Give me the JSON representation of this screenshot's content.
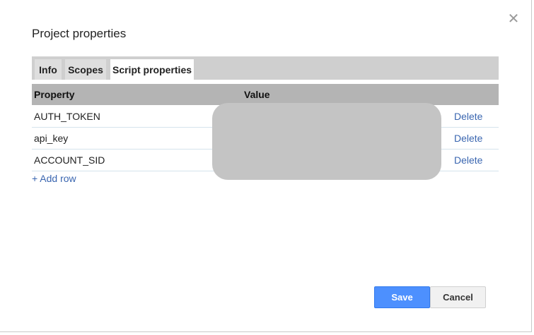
{
  "dialog": {
    "title": "Project properties",
    "close_icon": "close-icon"
  },
  "tabs": [
    {
      "label": "Info",
      "active": false
    },
    {
      "label": "Scopes",
      "active": false
    },
    {
      "label": "Script properties",
      "active": true
    }
  ],
  "table": {
    "columns": [
      "Property",
      "Value"
    ],
    "rows": [
      {
        "property": "AUTH_TOKEN",
        "value": "",
        "action": "Delete"
      },
      {
        "property": "api_key",
        "value": "",
        "action": "Delete"
      },
      {
        "property": "ACCOUNT_SID",
        "value": "",
        "action": "Delete"
      }
    ],
    "add_row_label": "+ Add row"
  },
  "buttons": {
    "save": "Save",
    "cancel": "Cancel"
  },
  "colors": {
    "primary": "#4d90fe",
    "link": "#3a66b0",
    "header_bg": "#b4b4b4",
    "tabbar_bg": "#cfcfcf"
  }
}
